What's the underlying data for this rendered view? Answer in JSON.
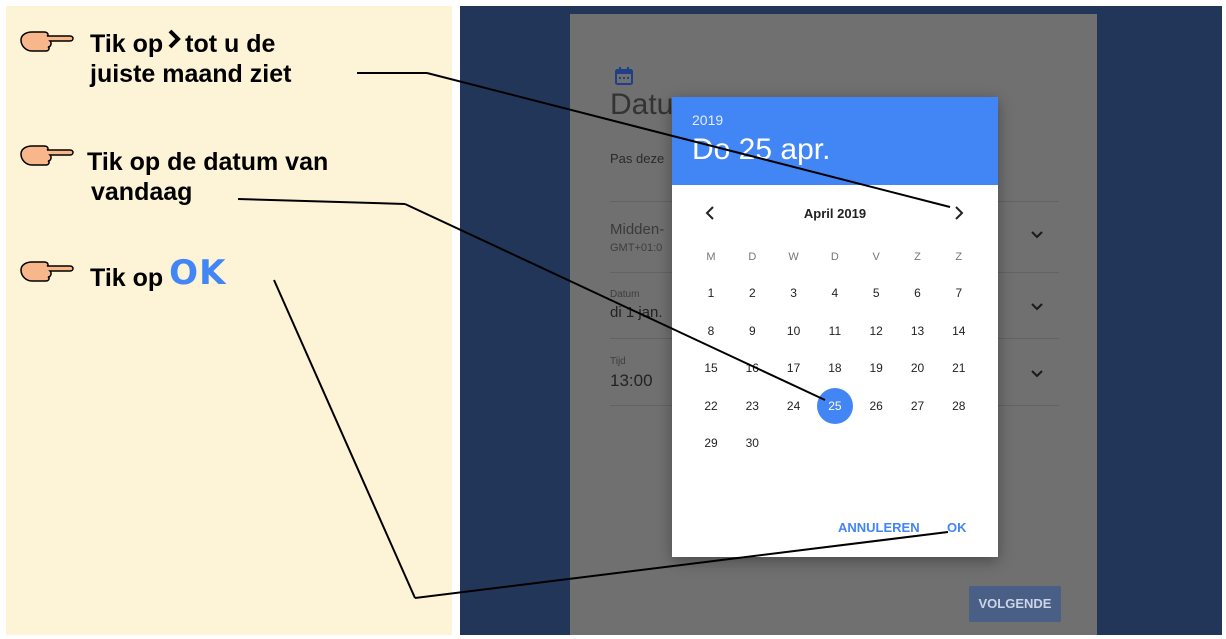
{
  "instructions": {
    "step1_part1": "Tik op",
    "step1_part2": "tot u de",
    "step1_line2": "juiste maand ziet",
    "step2_line1": "Tik op de datum van",
    "step2_line2": "vandaag",
    "step3_text": "Tik op",
    "step3_ok": "OK"
  },
  "background_form": {
    "title": "Datu",
    "subtitle": "Pas deze",
    "timezone_label": "Midden-",
    "timezone_value": "GMT+01:0",
    "date_label": "Datum",
    "date_value": "di 1 jan.",
    "time_label": "Tijd",
    "time_value": "13:00",
    "next_button": "VOLGENDE"
  },
  "date_picker": {
    "year": "2019",
    "selected_date": "Do 25 apr.",
    "month": "April 2019",
    "weekdays": [
      "M",
      "D",
      "W",
      "D",
      "V",
      "Z",
      "Z"
    ],
    "weeks": [
      [
        "1",
        "2",
        "3",
        "4",
        "5",
        "6",
        "7"
      ],
      [
        "8",
        "9",
        "10",
        "11",
        "12",
        "13",
        "14"
      ],
      [
        "15",
        "16",
        "17",
        "18",
        "19",
        "20",
        "21"
      ],
      [
        "22",
        "23",
        "24",
        "25",
        "26",
        "27",
        "28"
      ],
      [
        "29",
        "30"
      ]
    ],
    "selected_day": "25",
    "cancel_button": "ANNULEREN",
    "ok_button": "OK"
  },
  "colors": {
    "accent": "#4285f4",
    "panel": "#fdf3d6",
    "device_frame": "#223659"
  }
}
